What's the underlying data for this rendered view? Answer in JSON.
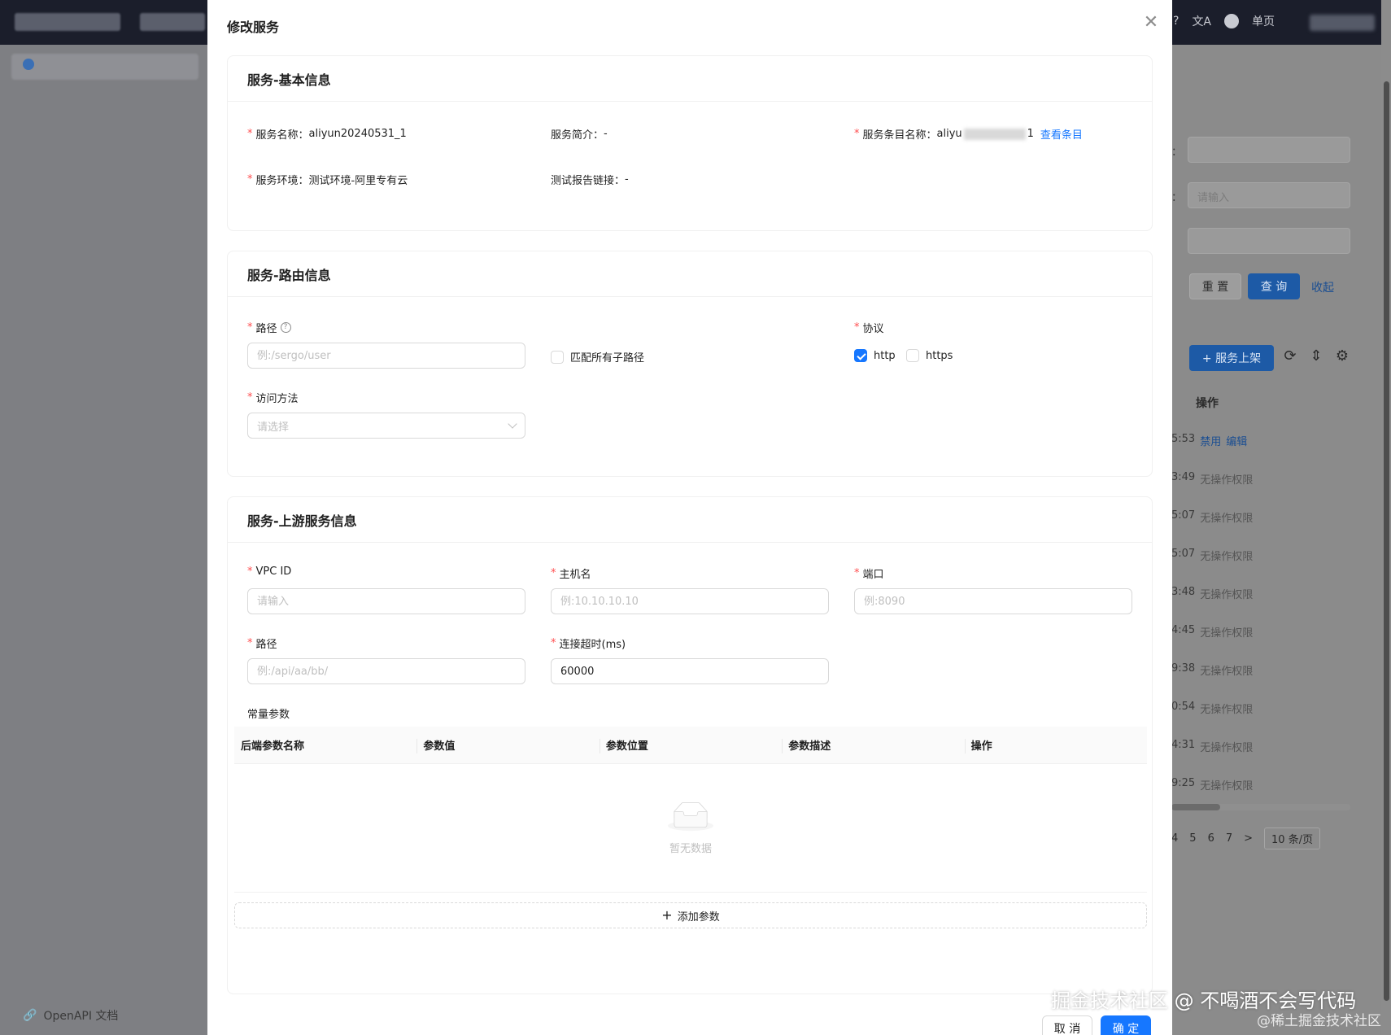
{
  "background": {
    "top_icons": {
      "lang": "文A",
      "view_mode": "单页"
    },
    "sidebar": {
      "footer_link": "OpenAPI 文档"
    },
    "filters": {
      "input_placeholder": "请输入"
    },
    "buttons": {
      "reset": "重 置",
      "search": "查 询",
      "collapse": "收起",
      "publish": "+ 服务上架"
    },
    "table": {
      "header_action": "操作",
      "rows": [
        {
          "time": "5:53",
          "actions": [
            "禁用",
            "编辑"
          ]
        },
        {
          "time": "3:49",
          "no_perm": "无操作权限"
        },
        {
          "time": "5:07",
          "no_perm": "无操作权限"
        },
        {
          "time": "5:07",
          "no_perm": "无操作权限"
        },
        {
          "time": "3:48",
          "no_perm": "无操作权限"
        },
        {
          "time": "4:45",
          "no_perm": "无操作权限"
        },
        {
          "time": "9:38",
          "no_perm": "无操作权限"
        },
        {
          "time": "0:54",
          "no_perm": "无操作权限"
        },
        {
          "time": "4:31",
          "no_perm": "无操作权限"
        },
        {
          "time": "9:25",
          "no_perm": "无操作权限"
        }
      ]
    },
    "pager": {
      "pages": [
        "4",
        "5",
        "6",
        "7"
      ],
      "next": ">",
      "page_size": "10 条/页"
    }
  },
  "modal": {
    "title": "修改服务",
    "basic": {
      "title": "服务-基本信息",
      "name_label": "服务名称：",
      "name_value": "aliyun20240531_1",
      "intro_label": "服务简介：",
      "intro_value": "-",
      "entry_label": "服务条目名称：",
      "entry_value_prefix": "aliyu",
      "entry_value_suffix": "1",
      "entry_link": "查看条目",
      "env_label": "服务环境：",
      "env_value": "测试环境-阿里专有云",
      "report_label": "测试报告链接：",
      "report_value": "-"
    },
    "route": {
      "title": "服务-路由信息",
      "path_label": "路径",
      "path_placeholder": "例:/sergo/user",
      "match_all_label": "匹配所有子路径",
      "protocol_label": "协议",
      "protocol_http": "http",
      "protocol_https": "https",
      "http_checked": true,
      "https_checked": false,
      "match_all_checked": false,
      "method_label": "访问方法",
      "method_placeholder": "请选择"
    },
    "upstream": {
      "title": "服务-上游服务信息",
      "vpc_label": "VPC ID",
      "vpc_placeholder": "请输入",
      "host_label": "主机名",
      "host_placeholder": "例:10.10.10.10",
      "port_label": "端口",
      "port_placeholder": "例:8090",
      "path_label": "路径",
      "path_placeholder": "例:/api/aa/bb/",
      "timeout_label": "连接超时(ms)",
      "timeout_value": "60000",
      "const_params_label": "常量参数",
      "columns": [
        "后端参数名称",
        "参数值",
        "参数位置",
        "参数描述",
        "操作"
      ],
      "empty_text": "暂无数据",
      "add_param": "添加参数"
    },
    "footer": {
      "cancel": "取 消",
      "ok": "确 定"
    }
  },
  "watermark": {
    "main": "掘金技术社区 @ 不喝酒不会写代码",
    "sub": "@稀土掘金技术社区"
  }
}
